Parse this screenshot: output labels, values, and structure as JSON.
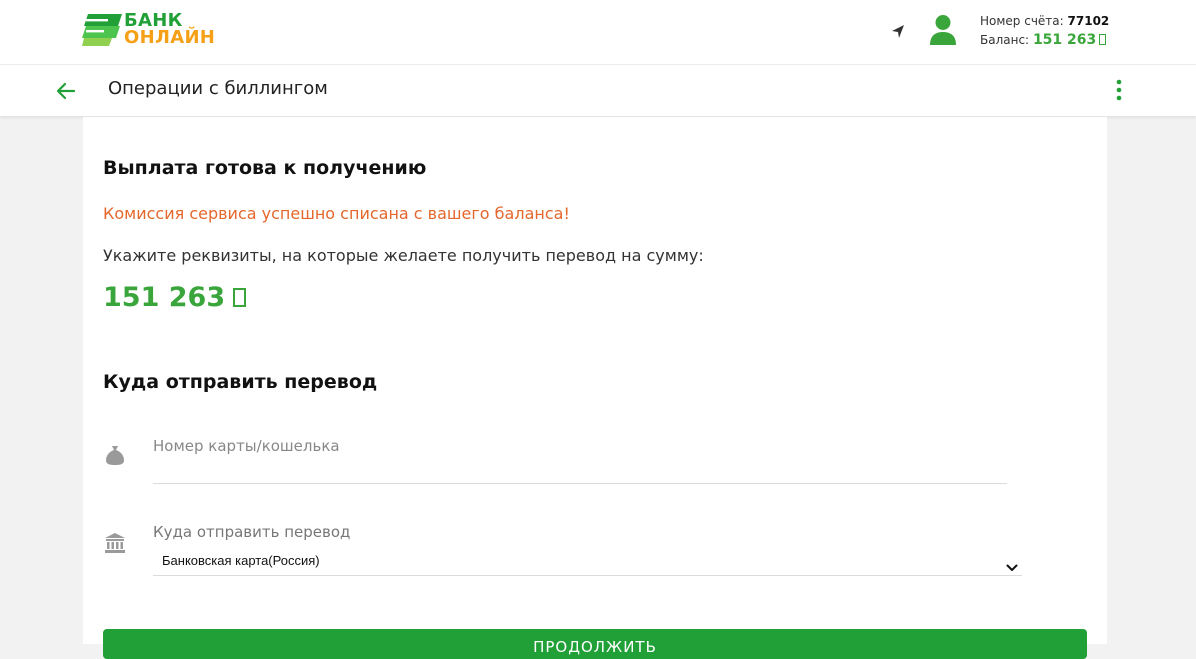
{
  "header": {
    "logo": {
      "line1": "БАНК",
      "line2": "ОНЛАЙН"
    },
    "icons": {
      "navigation": "location-arrow-icon",
      "user": "user-icon"
    },
    "account": {
      "number_label": "Номер счёта:",
      "number_value": "77102",
      "balance_label": "Баланс:",
      "balance_value": "151 263"
    }
  },
  "titlebar": {
    "back_icon": "arrow-left-icon",
    "title": "Операции с биллингом",
    "menu_icon": "more-vertical-icon"
  },
  "main": {
    "payout_heading": "Выплата готова к получению",
    "success_message": "Комиссия сервиса успешно списана с вашего баланса!",
    "instruction": "Укажите реквизиты, на которые желаете получить перевод на сумму:",
    "amount": "151 263",
    "destination_heading": "Куда отправить перевод",
    "card_field": {
      "icon": "money-bag-icon",
      "placeholder": "Номер карты/кошелька",
      "value": ""
    },
    "destination_field": {
      "icon": "bank-icon",
      "label": "Куда отправить перевод",
      "selected": "Банковская карта(Россия)"
    },
    "continue_label": "ПРОДОЛЖИТЬ"
  },
  "colors": {
    "brand_green": "#21a038",
    "brand_orange": "#f5a016",
    "amount_green": "#3aa53a",
    "success_orange": "#e4672b",
    "page_background": "#f2f2f2"
  }
}
